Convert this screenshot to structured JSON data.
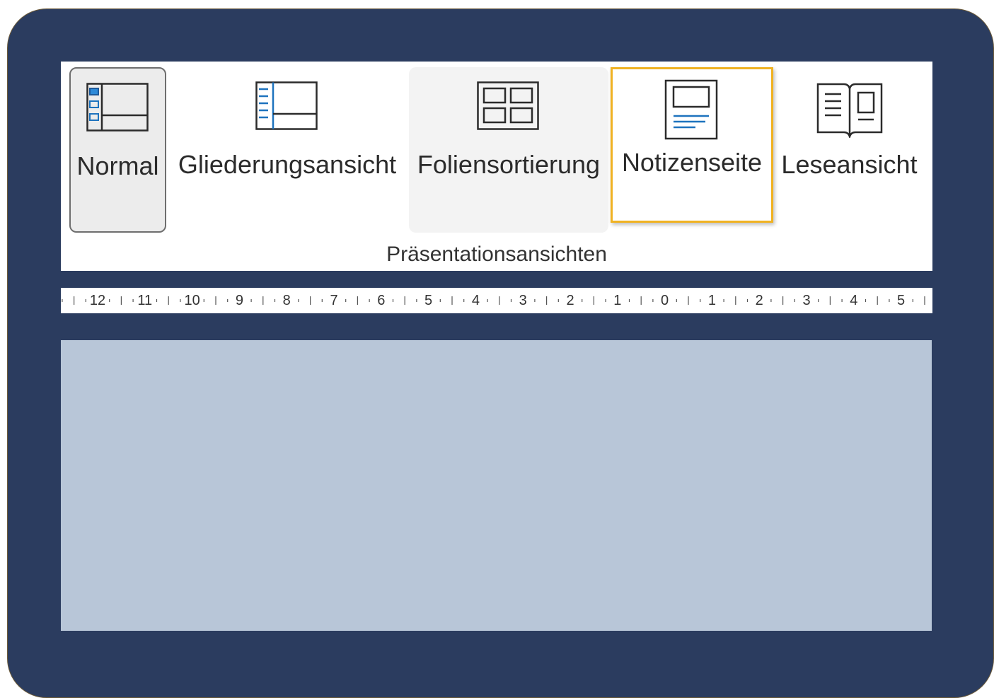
{
  "ribbon": {
    "buttons": {
      "normal": {
        "label": "Normal",
        "icon": "normal-view-icon"
      },
      "gliederung": {
        "label": "Gliederungsansicht",
        "icon": "outline-view-icon"
      },
      "folien": {
        "label": "Foliensortierung",
        "icon": "slide-sorter-icon"
      },
      "notizen": {
        "label": "Notizenseite",
        "icon": "notes-page-icon"
      },
      "lese": {
        "label": "Leseansicht",
        "icon": "reading-view-icon"
      }
    },
    "group_label": "Präsentationsansichten"
  },
  "ruler": {
    "labels": [
      "12",
      "11",
      "10",
      "9",
      "8",
      "7",
      "6",
      "5",
      "4",
      "3",
      "2",
      "1",
      "0",
      "1",
      "2",
      "3",
      "4",
      "5"
    ]
  },
  "colors": {
    "frame": "#2b3c5f",
    "highlight": "#f0b222",
    "accent_blue": "#1e73be",
    "slide_area": "#b8c6d8"
  }
}
